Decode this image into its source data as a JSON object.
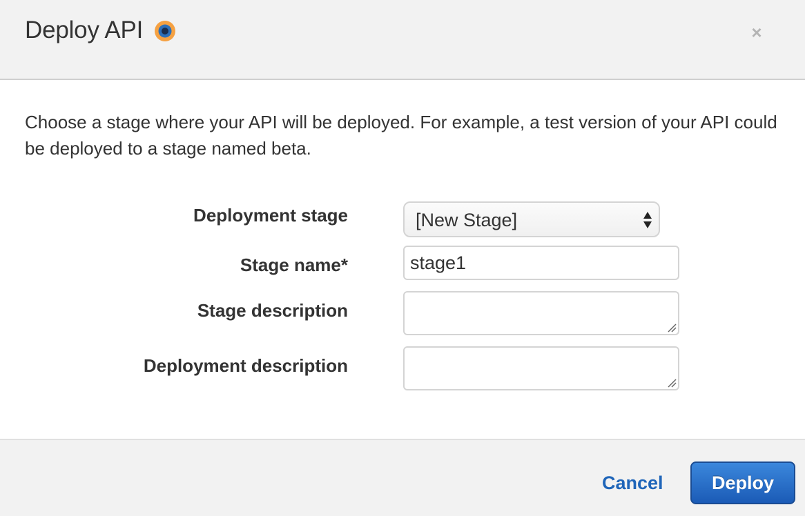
{
  "dialog": {
    "title": "Deploy API",
    "close_label": "×"
  },
  "body": {
    "intro": "Choose a stage where your API will be deployed. For example, a test version of your API could be deployed to a stage named beta."
  },
  "form": {
    "deployment_stage": {
      "label": "Deployment stage",
      "selected": "[New Stage]"
    },
    "stage_name": {
      "label": "Stage name*",
      "value": "stage1"
    },
    "stage_description": {
      "label": "Stage description",
      "value": ""
    },
    "deployment_description": {
      "label": "Deployment description",
      "value": ""
    }
  },
  "footer": {
    "cancel_label": "Cancel",
    "deploy_label": "Deploy"
  },
  "colors": {
    "header_bg": "#f2f2f2",
    "footer_bg": "#f2f2f2",
    "link": "#1f65b9",
    "primary_button": "#1b5bb6",
    "info_icon_outer": "#f5a142",
    "info_icon_inner": "#1f4f8a"
  },
  "icons": {
    "info": "info-icon",
    "close": "close-icon",
    "select_arrows": "updown-arrows-icon",
    "resize": "resize-grip-icon"
  }
}
